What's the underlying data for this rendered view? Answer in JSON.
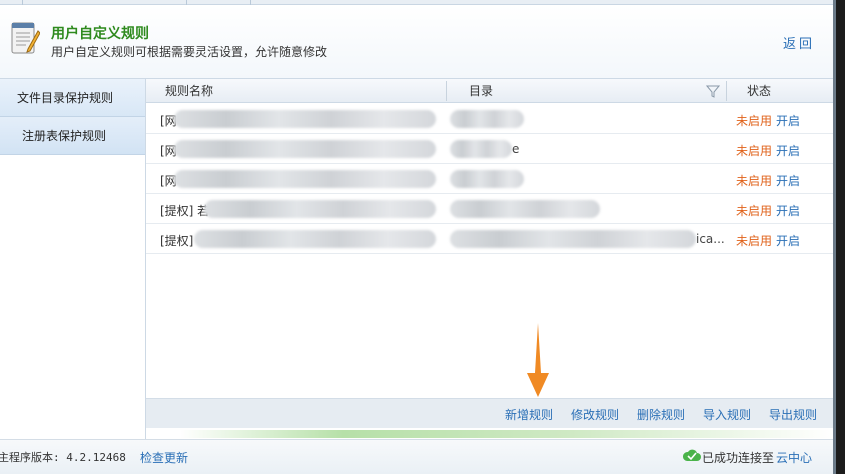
{
  "header": {
    "title": "用户自定义规则",
    "subtitle": "用户自定义规则可根据需要灵活设置，允许随意修改",
    "back_label": "返回",
    "logo_icon": "notepad-pencil-icon"
  },
  "sidebar": {
    "items": [
      {
        "label": "文件目录保护规则"
      },
      {
        "label": "注册表保护规则"
      }
    ]
  },
  "table": {
    "columns": {
      "name": "规则名称",
      "dir": "目录",
      "status": "状态"
    },
    "rows": [
      {
        "name": "[网",
        "dir": "",
        "status": "未启用",
        "action": "开启"
      },
      {
        "name": "[网",
        "dir": "e",
        "status": "未启用",
        "action": "开启"
      },
      {
        "name": "[网",
        "dir": "",
        "status": "未启用",
        "action": "开启"
      },
      {
        "name": "[提权] 若",
        "dir": "",
        "status": "未启用",
        "action": "开启"
      },
      {
        "name": "[提权]",
        "dir": "ica...",
        "status": "未启用",
        "action": "开启"
      }
    ]
  },
  "toolbar": {
    "add": "新增规则",
    "edit": "修改规则",
    "delete": "删除规则",
    "import": "导入规则",
    "export": "导出规则"
  },
  "status": {
    "version": "主程序版本: 4.2.12468",
    "check_update": "检查更新",
    "connected": "已成功连接至",
    "cloud": "云中心"
  },
  "colors": {
    "title_green": "#2e8a1e",
    "link_blue": "#2a6fb6",
    "disabled_orange": "#e0621a",
    "arrow_orange": "#f08a24"
  }
}
